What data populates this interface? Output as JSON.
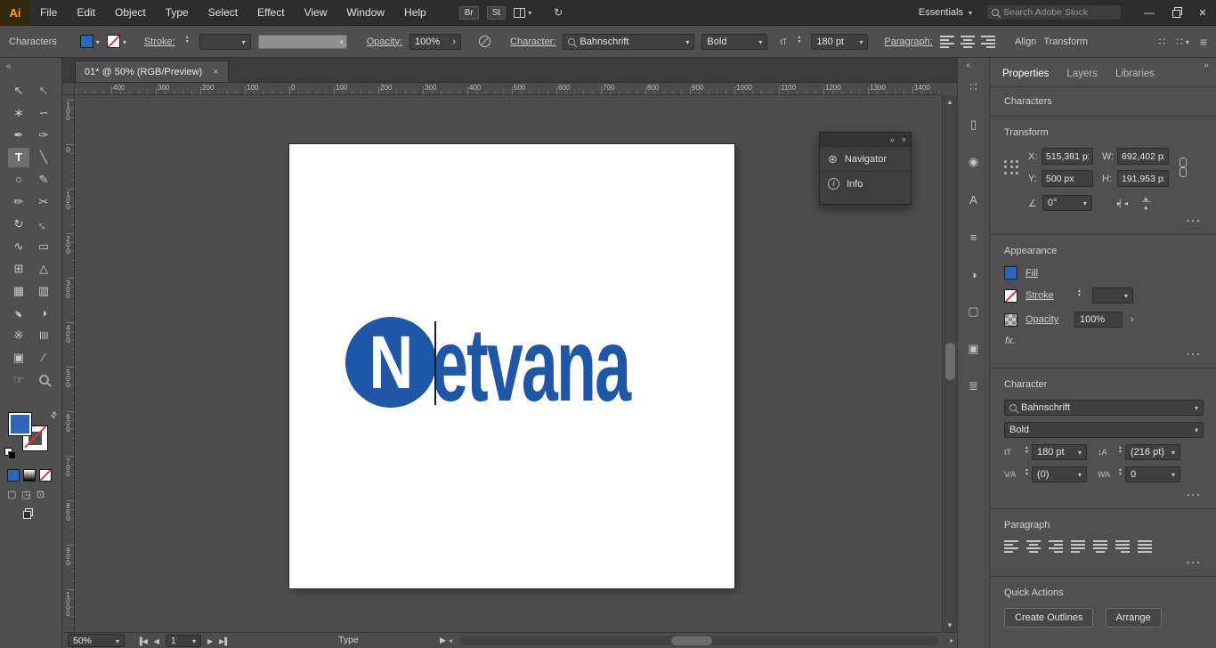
{
  "menubar": {
    "logo": "Ai",
    "menus": [
      "File",
      "Edit",
      "Object",
      "Type",
      "Select",
      "Effect",
      "View",
      "Window",
      "Help"
    ],
    "bridge": "Br",
    "stock": "St",
    "workspace": "Essentials",
    "search_placeholder": "Search Adobe Stock"
  },
  "controlbar": {
    "context_label": "Characters",
    "stroke_label": "Stroke:",
    "opacity_label": "Opacity:",
    "opacity_value": "100%",
    "character_label": "Character:",
    "font_name": "Bahnschrift",
    "font_style": "Bold",
    "font_size": "180 pt",
    "paragraph_label": "Paragraph:",
    "align_label": "Align",
    "transform_label": "Transform"
  },
  "tabbar": {
    "tab_title": "01* @ 50%  (RGB/Preview)"
  },
  "rulers": {
    "horizontal": [
      "400",
      "300",
      "200",
      "100",
      "0",
      "100",
      "200",
      "300",
      "400",
      "500",
      "600",
      "700",
      "800",
      "900",
      "1000",
      "1100",
      "1200",
      "1300",
      "1400"
    ],
    "vertical": [
      "100",
      "0",
      "100",
      "200",
      "300",
      "400",
      "500",
      "600",
      "700",
      "800",
      "900",
      "1000"
    ]
  },
  "canvas": {
    "logo_initial": "N",
    "logo_rest": "etvana"
  },
  "floating_panel": {
    "items": [
      "Navigator",
      "Info"
    ]
  },
  "tools": [
    {
      "name": "selection-tool",
      "glyph": "↖"
    },
    {
      "name": "direct-selection-tool",
      "glyph": "↖",
      "dim": true
    },
    {
      "name": "magic-wand-tool",
      "glyph": "∗"
    },
    {
      "name": "lasso-tool",
      "glyph": "∽"
    },
    {
      "name": "pen-tool",
      "glyph": "✒"
    },
    {
      "name": "curvature-tool",
      "glyph": "✑"
    },
    {
      "name": "type-tool",
      "glyph": "T",
      "selected": true
    },
    {
      "name": "line-segment-tool",
      "glyph": "╲"
    },
    {
      "name": "ellipse-tool",
      "glyph": "○"
    },
    {
      "name": "paintbrush-tool",
      "glyph": "✎"
    },
    {
      "name": "pencil-tool",
      "glyph": "✏"
    },
    {
      "name": "eraser-tool",
      "glyph": "✂"
    },
    {
      "name": "rotate-tool",
      "glyph": "↻"
    },
    {
      "name": "scale-tool",
      "glyph": "↔",
      "rot": 45
    },
    {
      "name": "width-tool",
      "glyph": "∿"
    },
    {
      "name": "free-transform-tool",
      "glyph": "▭"
    },
    {
      "name": "shape-builder-tool",
      "glyph": "⊞"
    },
    {
      "name": "perspective-grid-tool",
      "glyph": "△"
    },
    {
      "name": "mesh-tool",
      "glyph": "▦"
    },
    {
      "name": "gradient-tool",
      "glyph": "▥"
    },
    {
      "name": "eyedropper-tool",
      "glyph": "✒",
      "rot": 225
    },
    {
      "name": "blend-tool",
      "glyph": "◑"
    },
    {
      "name": "symbol-sprayer-tool",
      "glyph": "※"
    },
    {
      "name": "column-graph-tool",
      "glyph": "≣",
      "rot": 90
    },
    {
      "name": "artboard-tool",
      "glyph": "▣"
    },
    {
      "name": "slice-tool",
      "glyph": "∕"
    },
    {
      "name": "hand-tool",
      "glyph": "☞"
    },
    {
      "name": "zoom-tool",
      "glyph": "",
      "mag": true
    }
  ],
  "side_panels": [
    {
      "name": "grid-panel-icon",
      "glyph": "∷"
    },
    {
      "name": "artboards-panel-icon",
      "glyph": "▯"
    },
    {
      "name": "color-panel-icon",
      "glyph": "◉"
    },
    {
      "name": "character-styles-panel-icon",
      "glyph": "A"
    },
    {
      "name": "stroke-panel-icon",
      "glyph": "≡"
    },
    {
      "name": "swatches-panel-icon",
      "glyph": "◑"
    },
    {
      "name": "appearance-panel-icon",
      "glyph": "▢"
    },
    {
      "name": "layers-panel-icon",
      "glyph": "▣"
    },
    {
      "name": "align-panel-icon",
      "glyph": "≣"
    }
  ],
  "panel_tabs": [
    "Properties",
    "Layers",
    "Libraries"
  ],
  "properties": {
    "context_heading": "Characters",
    "transform": {
      "heading": "Transform",
      "x_label": "X:",
      "x_value": "515,381 px",
      "y_label": "Y:",
      "y_value": "500 px",
      "w_label": "W:",
      "w_value": "692,402 px",
      "h_label": "H:",
      "h_value": "191,953 px",
      "angle_value": "0°"
    },
    "appearance": {
      "heading": "Appearance",
      "fill_label": "Fill",
      "stroke_label": "Stroke",
      "opacity_label": "Opacity",
      "opacity_value": "100%",
      "fx_label": "fx."
    },
    "character": {
      "heading": "Character",
      "font_name": "Bahnschrift",
      "font_style": "Bold",
      "size_value": "180 pt",
      "leading_value": "(216 pt)",
      "kerning_value": "(0)",
      "tracking_value": "0"
    },
    "paragraph": {
      "heading": "Paragraph"
    },
    "quick_actions": {
      "heading": "Quick Actions",
      "buttons": [
        "Create Outlines",
        "Arrange"
      ]
    }
  },
  "controlbar_aligns": [
    "align-left",
    "align-center",
    "align-right"
  ],
  "paragraph_aligns": [
    "align-left",
    "align-center",
    "align-right",
    "justify-last-left",
    "justify-last-center",
    "justify-last-right",
    "justify-all"
  ],
  "statusbar": {
    "zoom": "50%",
    "artboard": "1",
    "status": "Type"
  },
  "icons": {
    "navigator_icon": "⊛",
    "close": "×",
    "minimize": "—",
    "collapse_left": "«",
    "collapse_right": "»",
    "swap": "⇄",
    "angle": "∠",
    "size_icon": "tT",
    "leading_icon": "↕A",
    "kerning_icon": "V⁄A",
    "tracking_icon": "WA",
    "hamburger": "≡",
    "dots": "∷",
    "sync": "↻",
    "first": "▐◀",
    "prev": "◀",
    "next": "▶",
    "last": "▶▌",
    "up": "▲",
    "down": "▼",
    "chevron_right": "›"
  },
  "colors": {
    "brand_blue": "#1e56a8",
    "swatch_blue": "#2e66bb"
  }
}
